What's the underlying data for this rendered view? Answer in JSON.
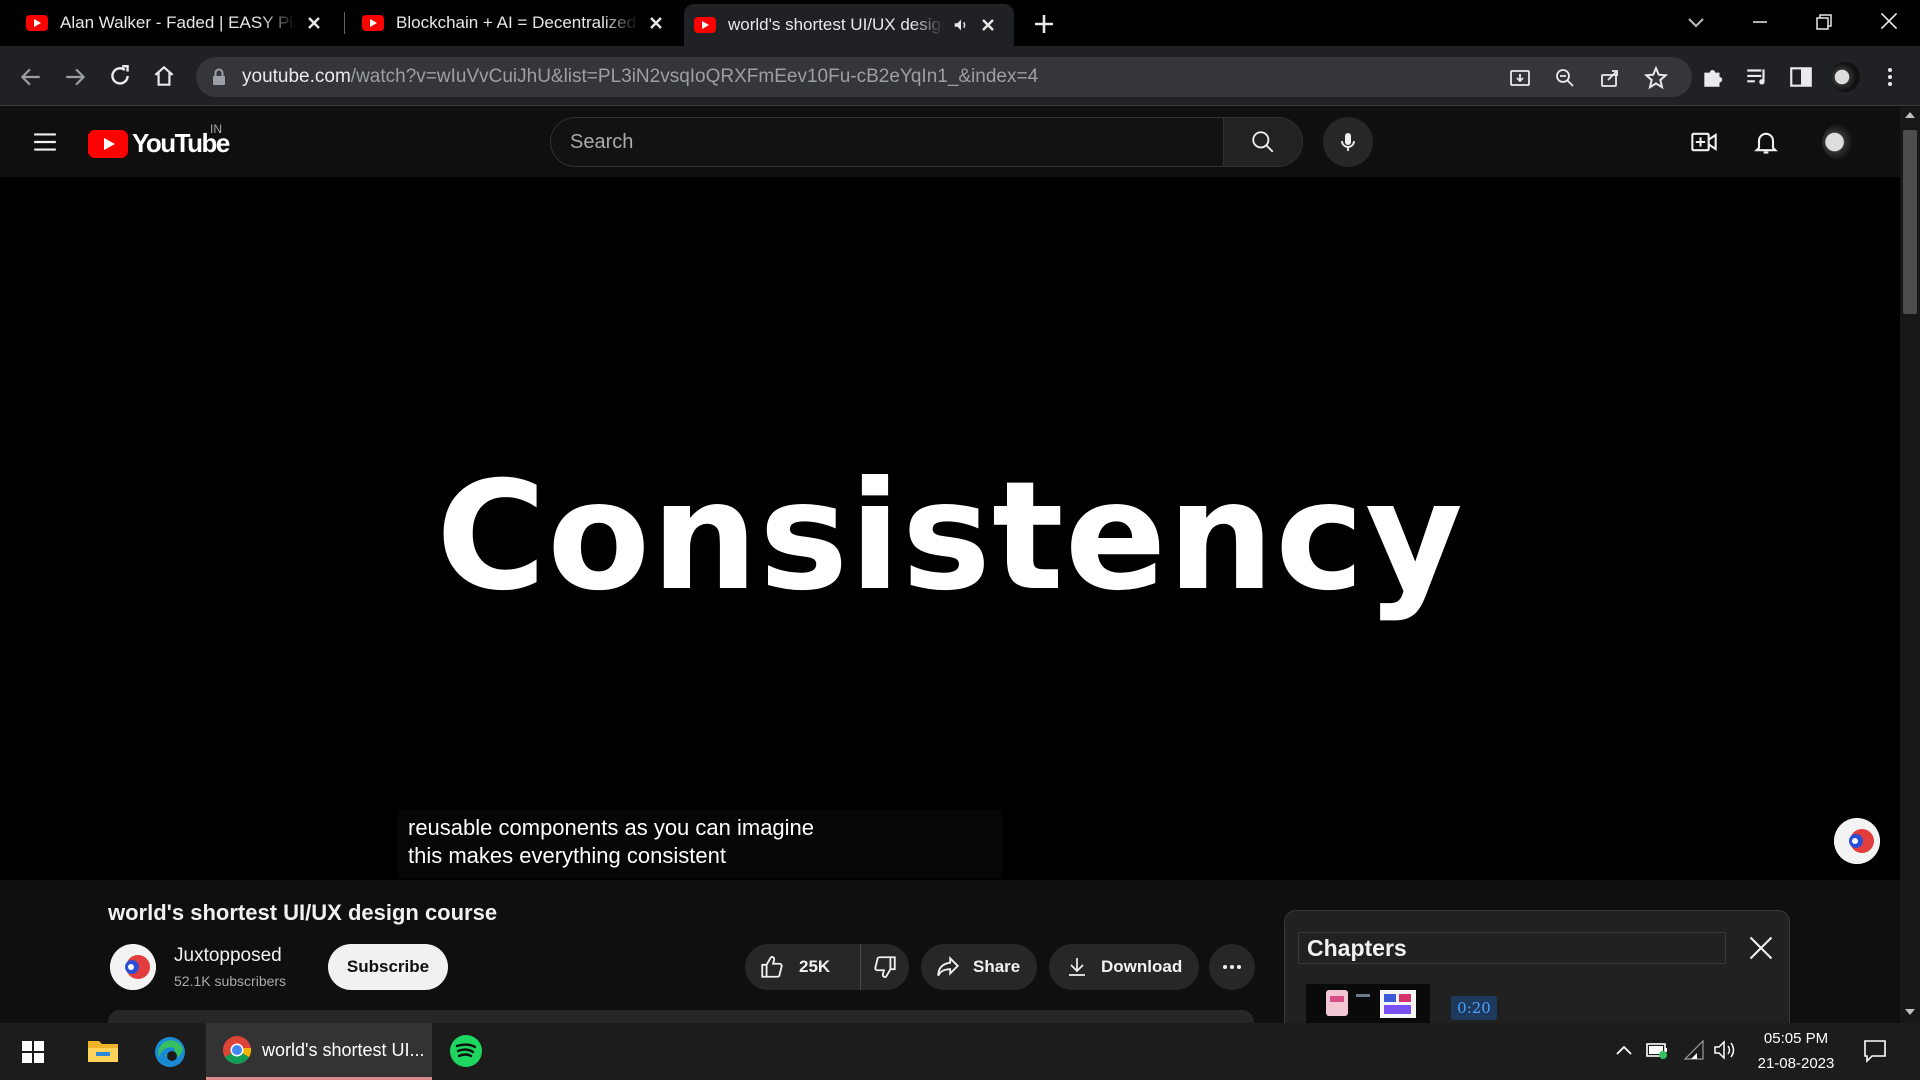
{
  "browser": {
    "tabs": [
      {
        "title": "Alan Walker - Faded | EASY Piano"
      },
      {
        "title": "Blockchain + AI = Decentralized AI"
      },
      {
        "title": "world's shortest UI/UX design course"
      }
    ],
    "url_host": "youtube.com",
    "url_path": "/watch?v=wIuVvCuiJhU&list=PL3iN2vsqIoQRXFmEev10Fu-cB2eYqIn1_&index=4"
  },
  "youtube": {
    "logo_text": "YouTube",
    "region": "IN",
    "search_placeholder": "Search"
  },
  "video": {
    "on_screen_word": "Consistency",
    "caption_line1": "reusable components as you can imagine",
    "caption_line2": "this makes everything consistent",
    "title": "world's shortest UI/UX design course",
    "channel_name": "Juxtopposed",
    "channel_subs": "52.1K subscribers",
    "subscribe_label": "Subscribe",
    "likes": "25K",
    "share_label": "Share",
    "download_label": "Download"
  },
  "chapters": {
    "title": "Chapters",
    "first_time": "0:20"
  },
  "taskbar": {
    "chrome_label": "world's shortest UI...",
    "time": "05:05 PM",
    "date": "21-08-2023"
  }
}
